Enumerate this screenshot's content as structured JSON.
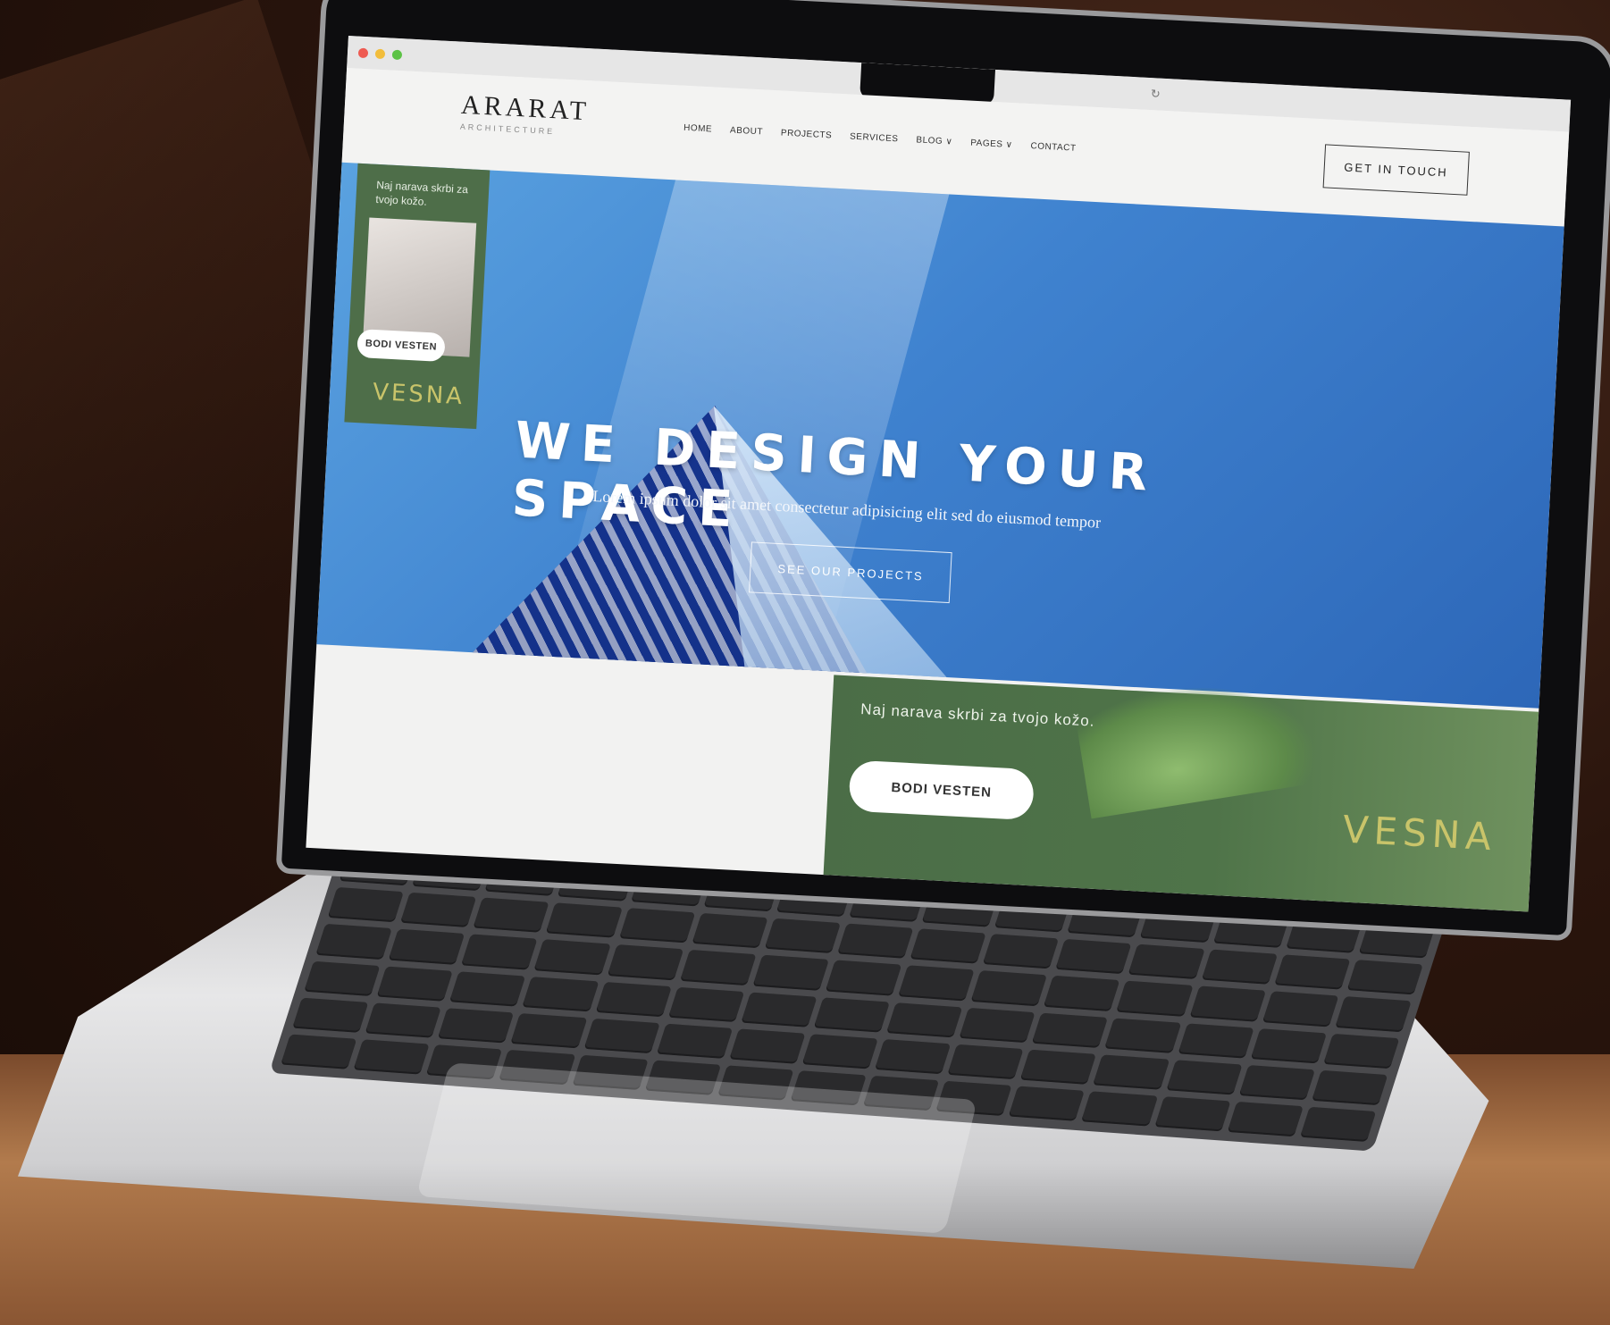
{
  "site": {
    "logo_title": "ARARAT",
    "logo_subtitle": "ARCHITECTURE",
    "nav": [
      {
        "label": "HOME"
      },
      {
        "label": "ABOUT"
      },
      {
        "label": "PROJECTS"
      },
      {
        "label": "SERVICES"
      },
      {
        "label": "BLOG ∨"
      },
      {
        "label": "PAGES ∨"
      },
      {
        "label": "CONTACT"
      }
    ],
    "cta_label": "GET IN TOUCH"
  },
  "hero": {
    "title": "WE DESIGN YOUR SPACE",
    "subtitle": "Lorem ipsum dolor sit amet consectetur adipisicing elit sed do eiusmod tempor",
    "button_label": "SEE OUR PROJECTS"
  },
  "ads": {
    "small": {
      "text": "Naj narava skrbi za tvojo kožo.",
      "button_label": "BODI VESTEN",
      "brand": "VESNA"
    },
    "large": {
      "text": "Naj narava skrbi za tvojo kožo.",
      "button_label": "BODI VESTEN",
      "brand": "VESNA"
    }
  },
  "colors": {
    "ad_green": "#4e6e49",
    "brand_gold": "#c9c46a",
    "hero_blue": "#3f82cf"
  }
}
